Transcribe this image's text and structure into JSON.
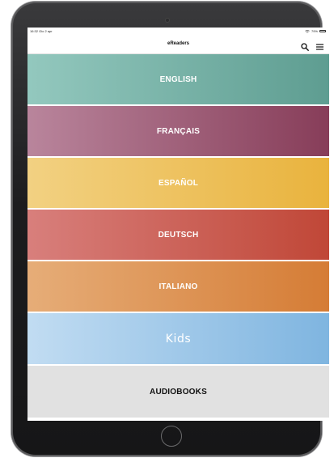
{
  "status_bar": {
    "time": "16:32  Gio 2 apr",
    "battery": "79%",
    "battery_level": 0.79
  },
  "nav": {
    "title": "eReaders",
    "search_icon": "search-icon",
    "menu_icon": "menu-icon"
  },
  "categories": [
    {
      "label": "ENGLISH",
      "color_start": "#93c8be",
      "color_end": "#5e9d91"
    },
    {
      "label": "FRANÇAIS",
      "color_start": "#b9859c",
      "color_end": "#873d59"
    },
    {
      "label": "ESPAÑOL",
      "color_start": "#f2d182",
      "color_end": "#e9b33d"
    },
    {
      "label": "DEUTSCH",
      "color_start": "#d87f7c",
      "color_end": "#c04737"
    },
    {
      "label": "ITALIANO",
      "color_start": "#e6ad78",
      "color_end": "#d57c35"
    },
    {
      "label": "Kids",
      "color_start": "#c1dcf2",
      "color_end": "#7fb5e0"
    },
    {
      "label": "AUDIOBOOKS",
      "color_start": "#e1e1e1",
      "color_end": "#e1e1e1"
    }
  ]
}
